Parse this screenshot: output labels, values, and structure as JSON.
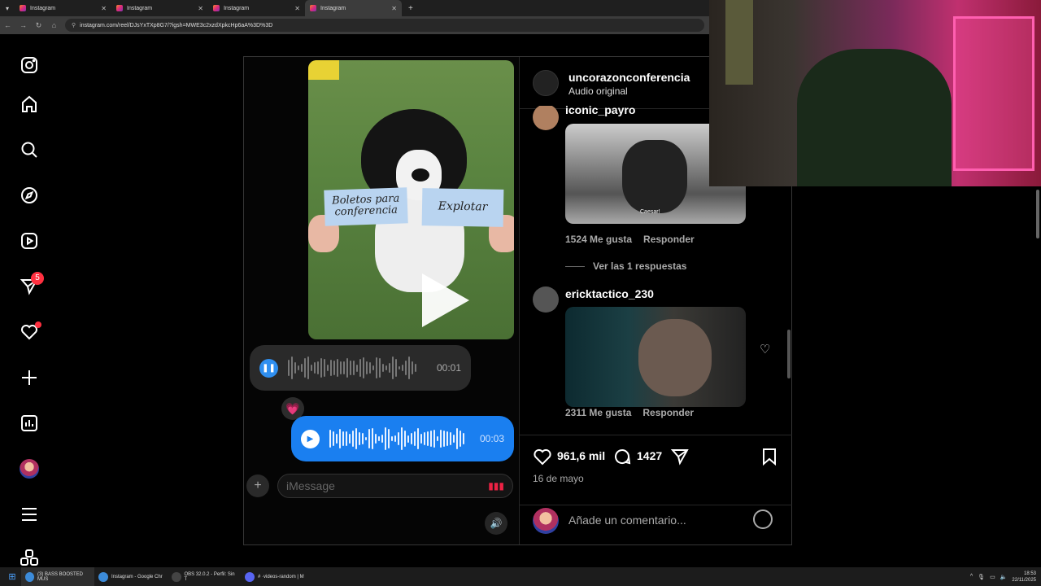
{
  "browser": {
    "tabs": [
      {
        "title": "Instagram",
        "active": false
      },
      {
        "title": "Instagram",
        "active": false
      },
      {
        "title": "Instagram",
        "active": false
      },
      {
        "title": "Instagram",
        "active": true
      }
    ],
    "url": "instagram.com/reel/DJsYxTXp8G7/?igsh=MWE3c2xzdXpkcHp6aA%3D%3D"
  },
  "sidebar": {
    "notifications_badge": "5"
  },
  "media": {
    "card_left": "Boletos para conferencia",
    "card_right": "Explotar",
    "voice_received_time": "00:01",
    "voice_sent_time": "00:03",
    "reaction_emoji": "💗",
    "imessage_placeholder": "iMessage"
  },
  "post": {
    "username": "uncorazonconferencia",
    "audio": "Audio original",
    "comments": [
      {
        "user": "iconic_payro",
        "likes": "1524 Me gusta",
        "reply": "Responder",
        "image_caption": "Caesar!"
      },
      {
        "user": "ericktactico_230",
        "likes": "2311 Me gusta",
        "reply": "Responder"
      }
    ],
    "view_replies": "Ver las 1 respuestas",
    "likes_count": "961,6 mil",
    "comments_count": "1427",
    "date": "16 de mayo",
    "add_comment_placeholder": "Añade un comentario..."
  },
  "taskbar": {
    "items": [
      {
        "label": "(3) BASS BOOSTED MUS",
        "color": "#3c8bd9"
      },
      {
        "label": "Instagram - Google Chr",
        "color": "#3c8bd9"
      },
      {
        "label": "OBS 32.0.2 - Perfil: Sin T",
        "color": "#444444"
      },
      {
        "label": "# ·videos-random | M",
        "color": "#5865f2"
      }
    ],
    "time": "18:53",
    "date": "22/11/2025"
  }
}
